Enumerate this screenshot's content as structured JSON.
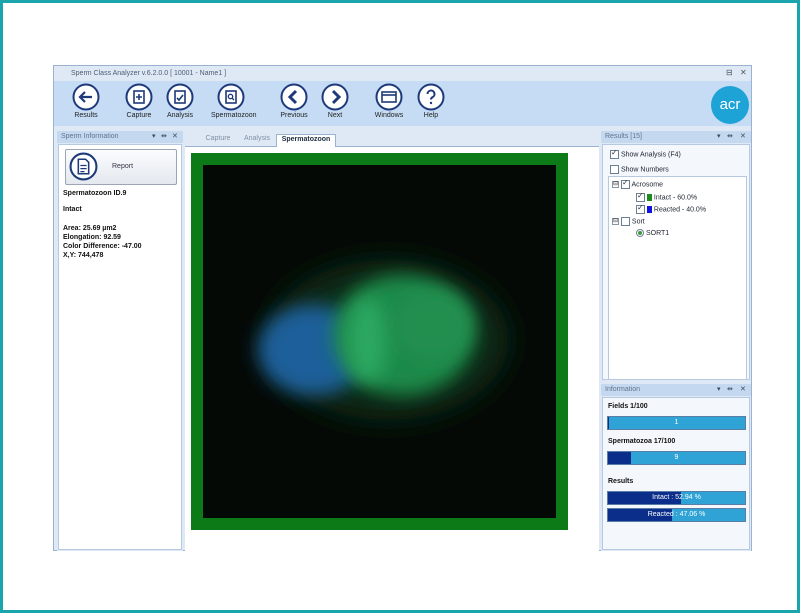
{
  "window": {
    "title": "Sperm Class Analyzer v.6.2.0.0  [ 10001 - Name1 ]",
    "controls": [
      "⊟",
      "✕"
    ]
  },
  "ribbon": {
    "buttons": [
      {
        "label": "Results",
        "icon": "back-arrow-icon"
      },
      {
        "label": "Capture",
        "icon": "capture-icon"
      },
      {
        "label": "Analysis",
        "icon": "analysis-icon"
      },
      {
        "label": "Spermatozoon",
        "icon": "spermatozoon-icon"
      },
      {
        "label": "Previous",
        "icon": "chevron-left-icon"
      },
      {
        "label": "Next",
        "icon": "chevron-right-icon"
      },
      {
        "label": "Windows",
        "icon": "windows-icon"
      },
      {
        "label": "Help",
        "icon": "help-icon"
      }
    ],
    "logo": "acr",
    "accent": "#1e3a7a"
  },
  "left_panel": {
    "title": "Sperm Information",
    "controls": [
      "▾",
      "⇹",
      "✕"
    ],
    "report_label": "Report",
    "sperm_id": "Spermatozoon ID.9",
    "class": "Intact",
    "area": "Area: 25.69  µm2",
    "elongation": "Elongation: 92.59",
    "color_difference": "Color Difference:  -47.00",
    "xy": "X,Y: 744,478"
  },
  "tabs": [
    {
      "label": "Capture",
      "active": false
    },
    {
      "label": "Analysis",
      "active": false
    },
    {
      "label": "Spermatozoon",
      "active": true
    }
  ],
  "results_panel": {
    "title": "Results [15]",
    "controls": [
      "▾",
      "⇹",
      "✕"
    ],
    "show_analysis": "Show Analysis (F4)",
    "show_analysis_checked": true,
    "show_numbers": "Show Numbers",
    "show_numbers_checked": false,
    "tree": {
      "acrosome": {
        "label": "Acrosome",
        "checked": true,
        "expander": "⊟"
      },
      "intact": {
        "label": "Intact - 60.0%",
        "checked": true,
        "color": "#1c8a1c"
      },
      "reacted": {
        "label": "Reacted - 40.0%",
        "checked": true,
        "color": "#1212e0"
      },
      "sort": {
        "label": "Sort",
        "checked": false,
        "expander": "⊟"
      },
      "sort1": {
        "label": "SORT1",
        "selected": true
      }
    }
  },
  "info_panel": {
    "title": "Information",
    "controls": [
      "▾",
      "⇹",
      "✕"
    ],
    "fields_label": "Fields 1/100",
    "fields_value": "1",
    "fields_fraction": 0.01,
    "spermatozoa_label": "Spermatozoa 17/100",
    "spermatozoa_value": "9",
    "spermatozoa_fraction": 0.17,
    "results_label": "Results",
    "intact_text": "Intact : 52.94 %",
    "intact_fraction": 0.5294,
    "reacted_text": "Reacted : 47.06 %",
    "reacted_fraction": 0.4706
  }
}
